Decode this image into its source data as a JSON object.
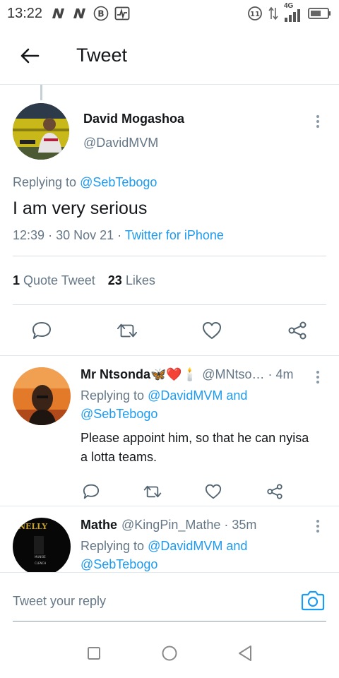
{
  "status_bar": {
    "time": "13:22",
    "left_icons": [
      "n-icon",
      "n-icon",
      "b-circle-icon",
      "activity-icon"
    ],
    "network_label": "4G"
  },
  "appbar": {
    "title": "Tweet"
  },
  "main_tweet": {
    "display_name": "David Mogashoa",
    "handle": "@DavidMVM",
    "replying_prefix": "Replying to",
    "replying_to": "@SebTebogo",
    "text": "I am very serious",
    "time": "12:39",
    "date": "30 Nov 21",
    "meta_sep": "·",
    "source": "Twitter for iPhone",
    "quote_count": "1",
    "quote_label": "Quote Tweet",
    "like_count": "23",
    "like_label": "Likes"
  },
  "replies": [
    {
      "display_name": "Mr Ntsonda🦋❤️🕯️",
      "handle": "@MNtso…",
      "age": "· 4m",
      "replying_prefix": "Replying to",
      "replying_to_1": "@DavidMVM",
      "replying_and": "and",
      "replying_to_2": "@SebTebogo",
      "text": "Please appoint him, so that he can nyisa a lotta teams."
    },
    {
      "display_name": "Mathe",
      "handle": "@KingPin_Mathe",
      "age": "· 35m",
      "replying_prefix": "Replying to",
      "replying_to_1": "@DavidMVM",
      "replying_and": "and",
      "replying_to_2": "@SebTebogo",
      "avatar_text_top": "NELLY",
      "avatar_text_mid": "MUNSIE",
      "avatar_text_bot": "CLENCH"
    }
  ],
  "compose": {
    "placeholder": "Tweet your reply"
  },
  "colors": {
    "accent": "#1d9bf0",
    "secondary_text": "#657786",
    "primary_text": "#14171a"
  }
}
